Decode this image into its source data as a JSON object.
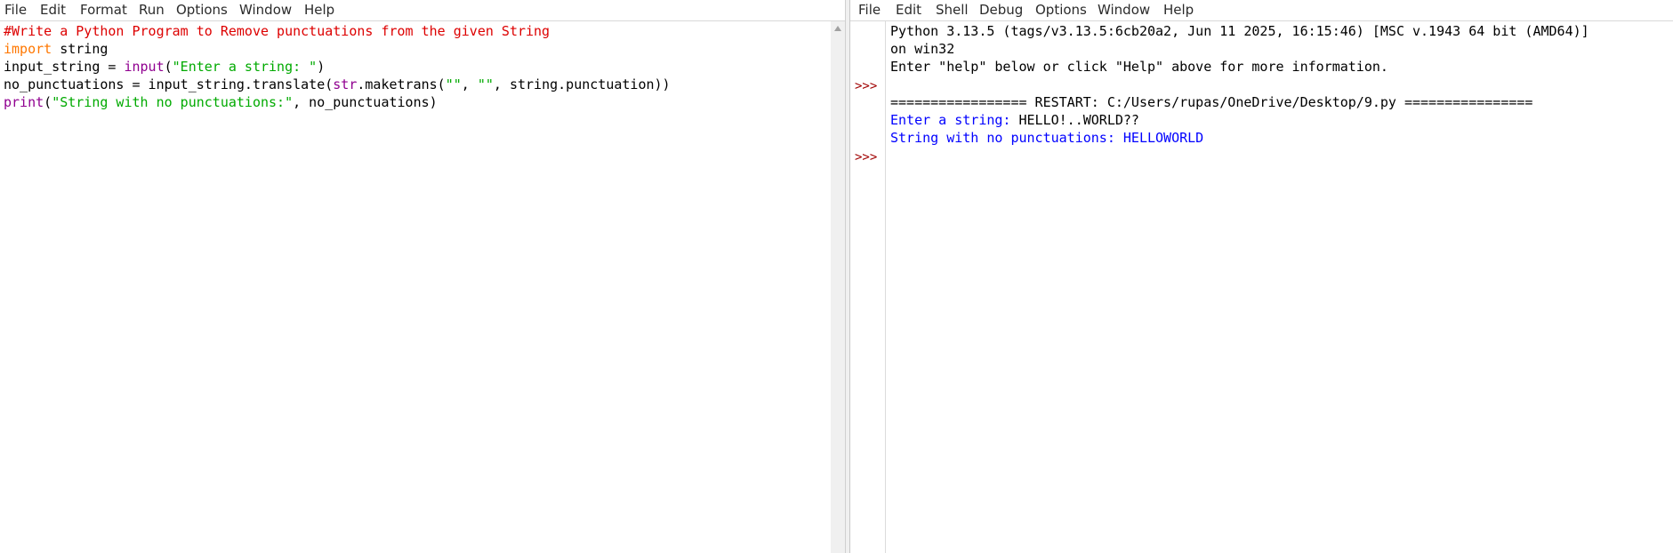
{
  "editor": {
    "menu": [
      "File",
      "Edit",
      "Format",
      "Run",
      "Options",
      "Window",
      "Help"
    ],
    "code": {
      "line1_comment": "#Write a Python Program to Remove punctuations from the given String",
      "line2_kw": "import",
      "line2_rest": " string",
      "line3_a": "input_string = ",
      "line3_fn": "input",
      "line3_b": "(",
      "line3_str": "\"Enter a string: \"",
      "line3_c": ")",
      "line4_a": "no_punctuations = input_string.translate(",
      "line4_fn": "str",
      "line4_b": ".maketrans(",
      "line4_str1": "\"\"",
      "line4_c": ", ",
      "line4_str2": "\"\"",
      "line4_d": ", string.punctuation))",
      "line5_fn": "print",
      "line5_a": "(",
      "line5_str": "\"String with no punctuations:\"",
      "line5_b": ", no_punctuations)"
    }
  },
  "shell": {
    "menu": [
      "File",
      "Edit",
      "Shell",
      "Debug",
      "Options",
      "Window",
      "Help"
    ],
    "prompt": ">>>",
    "banner1": "Python 3.13.5 (tags/v3.13.5:6cb20a2, Jun 11 2025, 16:15:46) [MSC v.1943 64 bit (AMD64)]",
    "banner2": "on win32",
    "banner3": "Enter \"help\" below or click \"Help\" above for more information.",
    "restart": "================= RESTART: C:/Users/rupas/OneDrive/Desktop/9.py ================",
    "output1_prompt": "Enter a string: ",
    "output1_input": "HELLO!..WORLD??",
    "output2": "String with no punctuations: HELLOWORLD"
  },
  "colors": {
    "keyword": "#ff7700",
    "builtin": "#900090",
    "string": "#00aa00",
    "comment": "#dd0000",
    "output": "#0000ff",
    "prompt": "#a00000"
  }
}
